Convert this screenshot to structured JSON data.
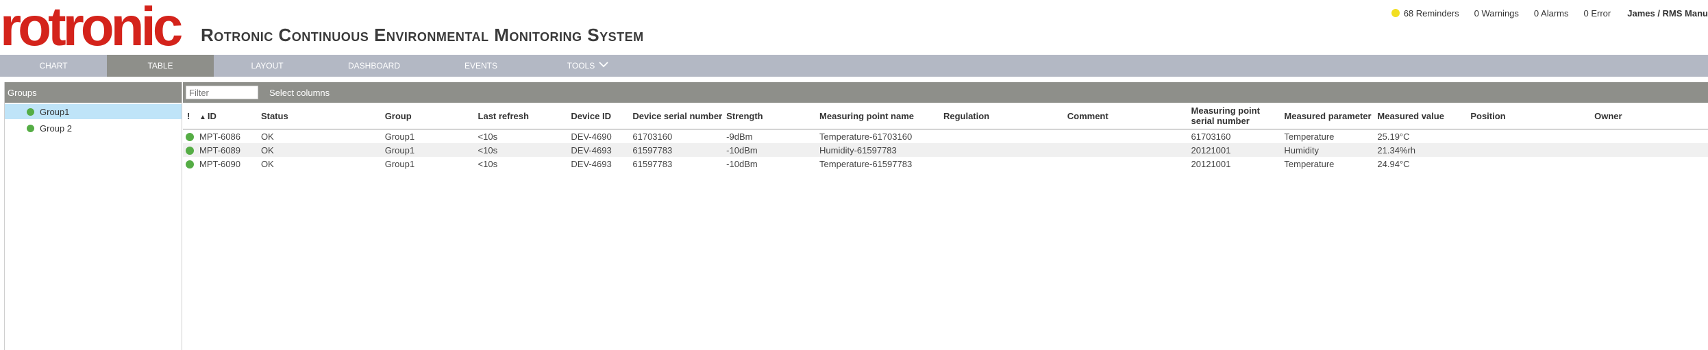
{
  "header": {
    "logo_text": "rotronic",
    "app_title": "Rotronic Continuous Environmental Monitoring System",
    "status": {
      "reminders": "68 Reminders",
      "warnings": "0 Warnings",
      "alarms": "0 Alarms",
      "errors": "0 Error",
      "user": "James / RMS Manu"
    }
  },
  "nav": {
    "items": [
      {
        "label": "CHART"
      },
      {
        "label": "TABLE"
      },
      {
        "label": "LAYOUT"
      },
      {
        "label": "DASHBOARD"
      },
      {
        "label": "EVENTS"
      },
      {
        "label": "TOOLS"
      }
    ],
    "active": "TABLE"
  },
  "sidebar": {
    "title": "Groups",
    "groups": [
      {
        "label": "Group1",
        "selected": true
      },
      {
        "label": "Group 2",
        "selected": false
      }
    ]
  },
  "grid": {
    "filter_placeholder": "Filter",
    "select_columns_label": "Select columns",
    "columns": [
      "!",
      "ID",
      "Status",
      "Group",
      "Last refresh",
      "Device ID",
      "Device serial number",
      "Strength",
      "Measuring point name",
      "Regulation",
      "Comment",
      "Measuring point serial number",
      "Measured parameter",
      "Measured value",
      "Position",
      "Owner"
    ],
    "rows": [
      {
        "id": "MPT-6086",
        "status": "OK",
        "group": "Group1",
        "last_refresh": "<10s",
        "device_id": "DEV-4690",
        "device_serial": "61703160",
        "strength": "-9dBm",
        "mp_name": "Temperature-61703160",
        "regulation": "",
        "comment": "",
        "mp_serial": "61703160",
        "parameter": "Temperature",
        "value": "25.19°C",
        "position": "",
        "owner": ""
      },
      {
        "id": "MPT-6089",
        "status": "OK",
        "group": "Group1",
        "last_refresh": "<10s",
        "device_id": "DEV-4693",
        "device_serial": "61597783",
        "strength": "-10dBm",
        "mp_name": "Humidity-61597783",
        "regulation": "",
        "comment": "",
        "mp_serial": "20121001",
        "parameter": "Humidity",
        "value": "21.34%rh",
        "position": "",
        "owner": ""
      },
      {
        "id": "MPT-6090",
        "status": "OK",
        "group": "Group1",
        "last_refresh": "<10s",
        "device_id": "DEV-4693",
        "device_serial": "61597783",
        "strength": "-10dBm",
        "mp_name": "Temperature-61597783",
        "regulation": "",
        "comment": "",
        "mp_serial": "20121001",
        "parameter": "Temperature",
        "value": "24.94°C",
        "position": "",
        "owner": ""
      }
    ]
  },
  "colors": {
    "brand_red": "#d4231b",
    "nav_bg": "#b3b8c4",
    "active_tab": "#8e8f8a",
    "ok_green": "#55ad45",
    "reminder_yellow": "#f2df21",
    "selected_row": "#bfe4f8"
  },
  "icons": {
    "reminder": "reminder-dot-icon",
    "status": "status-dot-icon",
    "sort": "sort-asc-icon",
    "dropdown": "chevron-down-icon"
  }
}
